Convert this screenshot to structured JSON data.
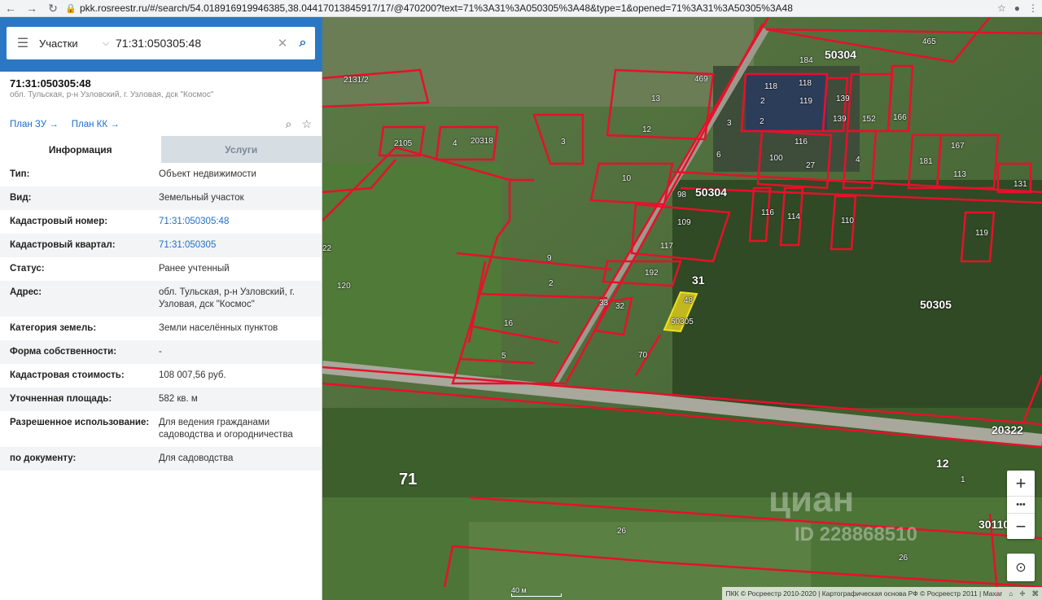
{
  "browser": {
    "url": "pkk.rosreestr.ru/#/search/54.018916919946385,38.04417013845917/17/@470200?text=71%3A31%3A050305%3A48&type=1&opened=71%3A31%3A50305%3A48"
  },
  "search": {
    "type": "Участки",
    "value": "71:31:050305:48"
  },
  "object": {
    "title": "71:31:050305:48",
    "address": "обл. Тульская, р-н Узловский, г. Узловая, дск \"Космос\"",
    "plan_zu": "План ЗУ →",
    "plan_kk": "План КК →"
  },
  "tabs": {
    "info": "Информация",
    "services": "Услуги"
  },
  "info_rows": [
    {
      "k": "Тип:",
      "v": "Объект недвижимости"
    },
    {
      "k": "Вид:",
      "v": "Земельный участок"
    },
    {
      "k": "Кадастровый номер:",
      "v": "71:31:050305:48"
    },
    {
      "k": "Кадастровый квартал:",
      "v": "71:31:050305"
    },
    {
      "k": "Статус:",
      "v": "Ранее учтенный"
    },
    {
      "k": "Адрес:",
      "v": "обл. Тульская, р-н Узловский, г. Узловая, дск \"Космос\""
    },
    {
      "k": "Категория земель:",
      "v": "Земли населённых пунктов"
    },
    {
      "k": "Форма собственности:",
      "v": "-"
    },
    {
      "k": "Кадастровая стоимость:",
      "v": "108 007,56 руб."
    },
    {
      "k": "Уточненная площадь:",
      "v": "582 кв. м"
    },
    {
      "k": "Разрешенное использование:",
      "v": "Для ведения гражданами садоводства и огородничества"
    },
    {
      "k": "по документу:",
      "v": "Для садоводства"
    }
  ],
  "map": {
    "labels": {
      "l465": "465",
      "l184": "184",
      "l50304a": "50304",
      "l2131_2": "2131/2",
      "l469": "469",
      "l118a": "118",
      "l118b": "118",
      "l119": "119",
      "l139a": "139",
      "l139b": "139",
      "l152": "152",
      "l166": "166",
      "l13": "13",
      "l12": "12",
      "l2105": "2105",
      "l4a": "4",
      "l20318": "20318",
      "l3a": "3",
      "l3b": "3",
      "l2a": "2",
      "l2b": "2",
      "l6": "6",
      "l100": "100",
      "l116a": "116",
      "l27": "27",
      "l4b": "4",
      "l181": "181",
      "l113": "113",
      "l167": "167",
      "l131": "131",
      "l10": "10",
      "l98": "98",
      "l50304b": "50304",
      "l116b": "116",
      "l114": "114",
      "l110": "110",
      "l119b": "119",
      "l109": "109",
      "l117": "117",
      "l192": "192",
      "l9": "9",
      "l2c": "2",
      "l22": "22",
      "l120": "120",
      "l31": "31",
      "l33": "33",
      "l32": "32",
      "l48": "48",
      "l50305a": "50305",
      "l50305b": "50305",
      "l16": "16",
      "l5": "5",
      "l70": "70",
      "l20322": "20322",
      "l71": "71",
      "l12b": "12",
      "l1": "1",
      "l26a": "26",
      "l26b": "26",
      "l30110": "30110"
    },
    "scale": "40 м",
    "attribution": "ПКК © Росреестр 2010-2020 | Картографическая основа РФ © Росреестр 2011 | Maxar",
    "watermark": "циан",
    "watermark_id": "ID 228868510",
    "zoom_in": "+",
    "zoom_out": "−",
    "more": "•••"
  },
  "colors": {
    "accent": "#2a78c4",
    "boundary": "#e8102a",
    "selected": "#f0e020"
  }
}
